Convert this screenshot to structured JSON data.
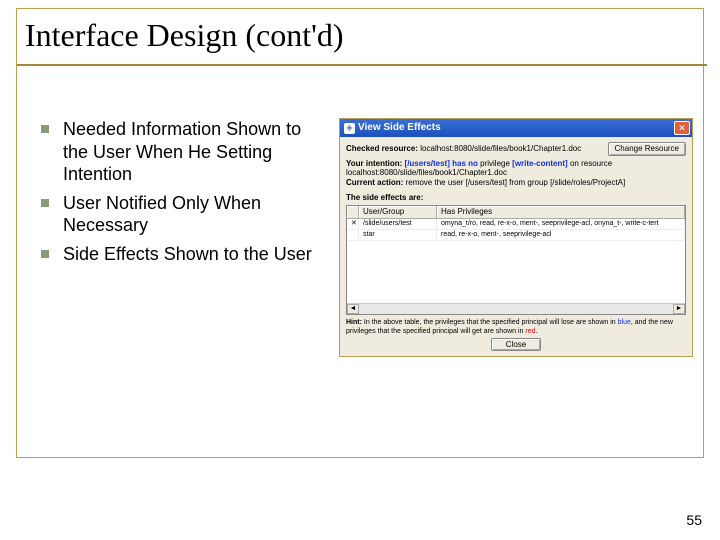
{
  "slide": {
    "title": "Interface Design (cont'd)",
    "page_number": "55"
  },
  "bullets": [
    "Needed Information Shown to the User When He Setting Intention",
    "User Notified Only When Necessary",
    "Side Effects Shown to the User"
  ],
  "dialog": {
    "titlebar": "View Side Effects",
    "checked_label": "Checked resource:",
    "checked_value": "localhost:8080/slide/files/book1/Chapter1.doc",
    "change_btn": "Change Resource",
    "intention_prefix": "Your intention:",
    "intention_user": "[/users/test]",
    "intention_mid": "has no",
    "intention_priv_label": "privilege",
    "intention_priv_value": "[write-content]",
    "intention_suffix": "on resource",
    "resource_line": "localhost:8080/slide/files/book1/Chapter1.doc",
    "current_action_label": "Current action:",
    "current_action_value": "remove the user [/users/test] from group [/slide/roles/ProjectA]",
    "side_effects_label": "The side effects are:",
    "columns": [
      "",
      "User/Group",
      "Has Privileges"
    ],
    "rows": [
      {
        "icon": "✕",
        "ug": "/slide/users/test",
        "priv": "omyna_t/ro, read, re-x-o, ment-, seeprivilege-acl, onyna_t-, write-c-tert"
      },
      {
        "icon": "",
        "ug": "star",
        "priv": "read, re-x-o, ment-, seeprivilege-acl"
      }
    ],
    "hint_prefix": "Hint:",
    "hint_body_1": "In the above table, the privileges that the specified principal will lose are shown in",
    "hint_blue": "blue",
    "hint_body_2": ", and the new privileges that the specified principal will get are shown in",
    "hint_red": "red",
    "close_btn": "Close"
  }
}
